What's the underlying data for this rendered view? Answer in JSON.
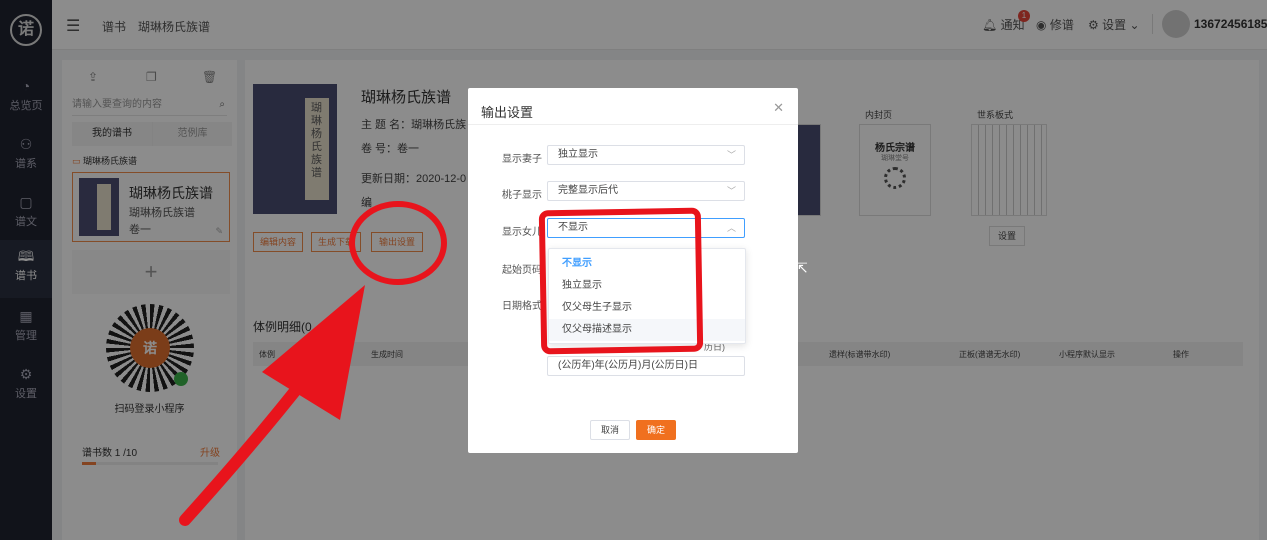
{
  "nav": {
    "logo": "诺",
    "items": [
      {
        "label": "总览页",
        "icon": "◔"
      },
      {
        "label": "谱系",
        "icon": "⚇"
      },
      {
        "label": "谱文",
        "icon": "▢"
      },
      {
        "label": "谱书",
        "icon": "🕮"
      },
      {
        "label": "管理",
        "icon": "▦"
      },
      {
        "label": "设置",
        "icon": "⚙"
      }
    ]
  },
  "topbar": {
    "breadcrumb": [
      "谱书",
      "瑚琳杨氏族谱"
    ],
    "notifications_label": "通知",
    "notifications_count": "1",
    "repair_label": "修谱",
    "settings_label": "设置",
    "user_phone": "13672456185"
  },
  "library": {
    "search_placeholder": "请输入要查询的内容",
    "tabs": [
      "我的谱书",
      "范例库"
    ],
    "folder": "瑚琳杨氏族谱",
    "book": {
      "title": "瑚琳杨氏族谱",
      "subtitle": "瑚琳杨氏族谱",
      "volume": "卷一"
    },
    "qr_label": "扫码登录小程序",
    "count_label": "谱书数",
    "count_value": "1 /10",
    "count_fraction": 0.1,
    "upgrade": "升级"
  },
  "book_detail": {
    "cover_text": "瑚琳杨氏族谱",
    "title": "瑚琳杨氏族谱",
    "main_title_row": "主 题 名：瑚琳杨氏族",
    "volume_row": "卷        号：卷一",
    "updated_row": "更新日期：2020-12-0",
    "edit_row": "编",
    "buttons": [
      "编辑内容",
      "生成下载",
      "输出设置"
    ],
    "inner_page_label": "内封页",
    "inner_page_title": "杨氏宗谱",
    "inner_page_sub": "瑚琳堂号",
    "lineage_label": "世系板式",
    "settings_button": "设置",
    "table_title": "体例明细(0",
    "table_headers": [
      "体例",
      "生成时间",
      "遗样(标谱带水印)",
      "正板(谱谱无水印)",
      "小程序默认显示",
      "操作"
    ]
  },
  "modal": {
    "title": "输出设置",
    "fields": [
      {
        "label": "显示妻子",
        "value": "独立显示"
      },
      {
        "label": "桃子显示",
        "value": "完整显示后代"
      },
      {
        "label": "显示女儿",
        "value": "不显示"
      },
      {
        "label": "起始页码",
        "value": ""
      },
      {
        "label": "日期格式",
        "value": "(公历年)年(公历月)月(公历日)日"
      }
    ],
    "hidden_row_fragment": "历日)",
    "dropdown_options": [
      "不显示",
      "独立显示",
      "仅父母生子显示",
      "仅父母描述显示"
    ],
    "cancel": "取消",
    "confirm": "确定"
  },
  "colors": {
    "accent": "#f07c3c",
    "annotation": "#e8141c",
    "selected": "#409eff",
    "sidebar": "#1f2330"
  }
}
